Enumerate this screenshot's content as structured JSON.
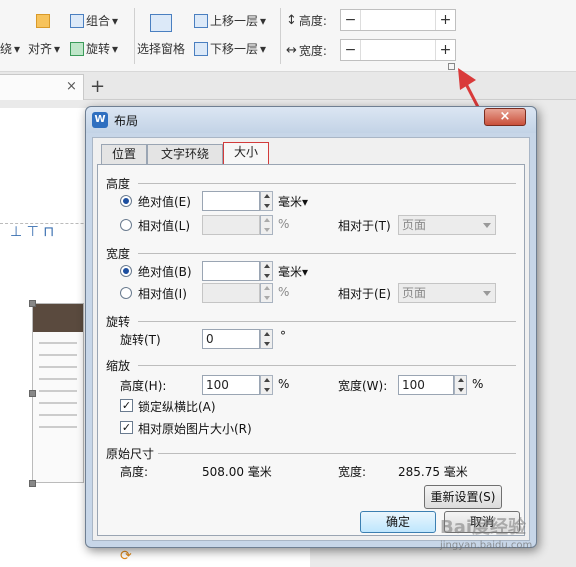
{
  "ribbon": {
    "wrap_label": "绕",
    "align_label": "对齐",
    "group_label": "组合",
    "rotate_label": "旋转",
    "selection_pane_label": "选择窗格",
    "bring_forward_label": "上移一层",
    "send_backward_label": "下移一层",
    "height_label": "高度:",
    "width_label": "宽度:",
    "minus": "−",
    "plus": "+"
  },
  "tabbar": {
    "close": "×",
    "new_tab": "+"
  },
  "dialog": {
    "title": "布局",
    "app_icon_letter": "W",
    "close": "×",
    "tabs": [
      "位置",
      "文字环绕",
      "大小"
    ],
    "active_tab": "大小",
    "height": {
      "section": "高度",
      "absolute_label": "绝对值(E)",
      "absolute_value": "",
      "absolute_unit": "毫米▾",
      "relative_label": "相对值(L)",
      "relative_value": "",
      "relative_unit": "%",
      "relative_to_label": "相对于(T)",
      "relative_to_value": "页面"
    },
    "width": {
      "section": "宽度",
      "absolute_label": "绝对值(B)",
      "absolute_value": "",
      "absolute_unit": "毫米▾",
      "relative_label": "相对值(I)",
      "relative_value": "",
      "relative_unit": "%",
      "relative_to_label": "相对于(E)",
      "relative_to_value": "页面"
    },
    "rotation": {
      "section": "旋转",
      "label": "旋转(T)",
      "value": "0",
      "unit": "°"
    },
    "scale": {
      "section": "缩放",
      "height_label": "高度(H):",
      "height_value": "100",
      "height_unit": "%",
      "width_label": "宽度(W):",
      "width_value": "100",
      "width_unit": "%",
      "lock_aspect_label": "锁定纵横比(A)",
      "lock_aspect_checked": true,
      "relative_original_label": "相对原始图片大小(R)",
      "relative_original_checked": true
    },
    "original_size": {
      "section": "原始尺寸",
      "height_label": "高度:",
      "height_value": "508.00 毫米",
      "width_label": "宽度:",
      "width_value": "285.75 毫米",
      "reset_label": "重新设置(S)"
    },
    "ok_label": "确定",
    "cancel_label": "取消"
  },
  "watermark": {
    "brand": "Bai度经验",
    "url": "jingyan.baidu.com"
  },
  "colors": {
    "accent_red": "#d93a3a",
    "title_blue": "#2f6fc0"
  }
}
